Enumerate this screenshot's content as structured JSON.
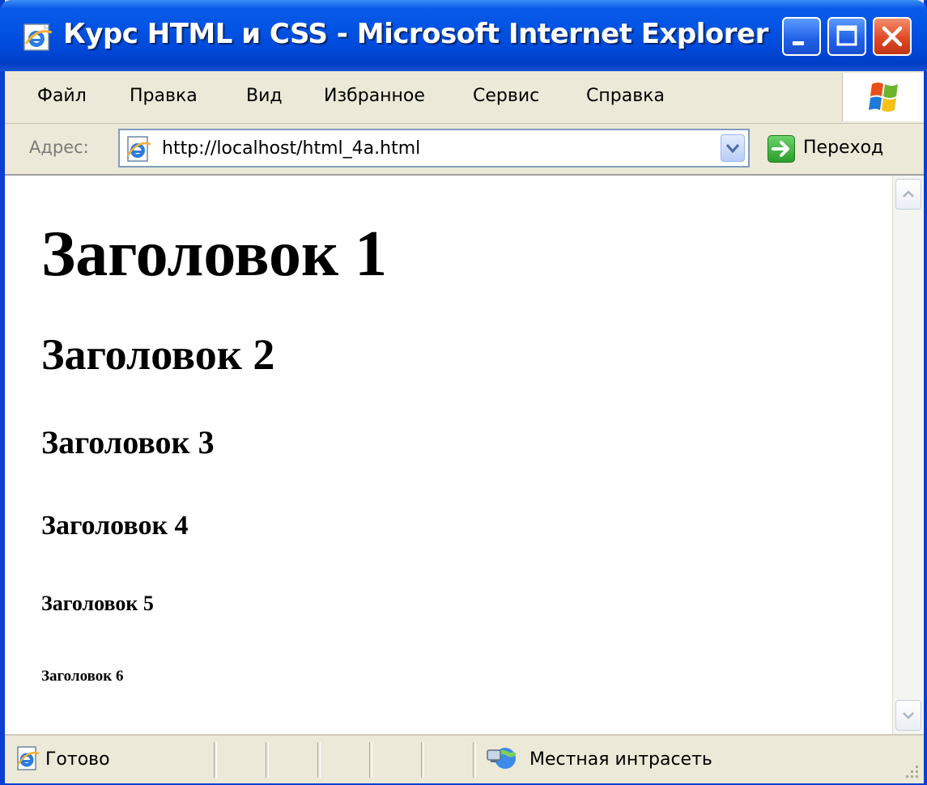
{
  "window": {
    "title": "Курс HTML и CSS - Microsoft Internet Explorer"
  },
  "menu": {
    "items": [
      "Файл",
      "Правка",
      "Вид",
      "Избранное",
      "Сервис",
      "Справка"
    ]
  },
  "address": {
    "label": "Адрес:",
    "url": "http://localhost/html_4a.html",
    "go_label": "Переход"
  },
  "page": {
    "h1": "Заголовок 1",
    "h2": "Заголовок 2",
    "h3": "Заголовок 3",
    "h4": "Заголовок 4",
    "h5": "Заголовок 5",
    "h6": "Заголовок 6"
  },
  "status": {
    "text": "Готово",
    "zone": "Местная интрасеть"
  },
  "icons": {
    "title": "ie-icon",
    "address": "ie-page-icon",
    "go": "go-arrow-icon",
    "status": "ie-page-icon",
    "zone": "intranet-icon"
  },
  "colors": {
    "titlebar": "#0153e3",
    "close_button": "#e04a24",
    "chrome": "#ece9d8",
    "go_button": "#2a9d2a"
  }
}
